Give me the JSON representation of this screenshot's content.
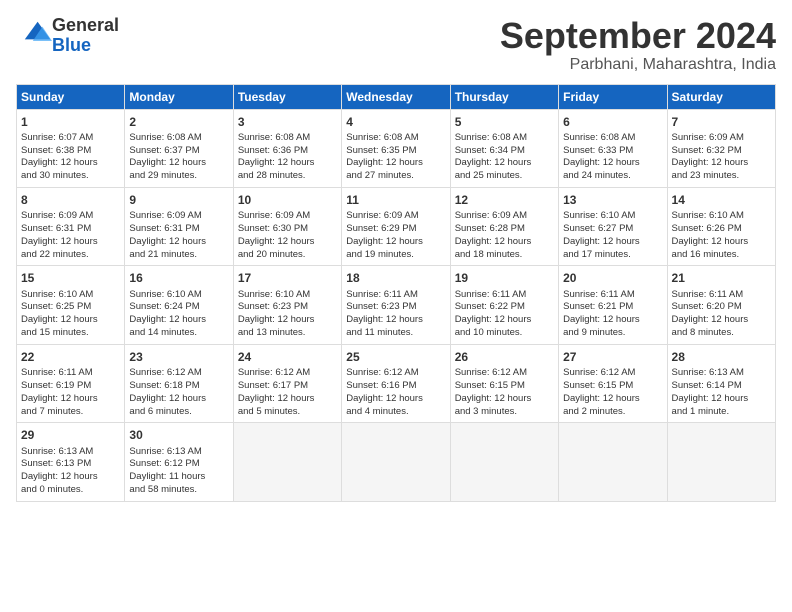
{
  "header": {
    "logo_general": "General",
    "logo_blue": "Blue",
    "month_title": "September 2024",
    "location": "Parbhani, Maharashtra, India"
  },
  "days_of_week": [
    "Sunday",
    "Monday",
    "Tuesday",
    "Wednesday",
    "Thursday",
    "Friday",
    "Saturday"
  ],
  "weeks": [
    [
      {
        "day": "1",
        "lines": [
          "Sunrise: 6:07 AM",
          "Sunset: 6:38 PM",
          "Daylight: 12 hours",
          "and 30 minutes."
        ]
      },
      {
        "day": "2",
        "lines": [
          "Sunrise: 6:08 AM",
          "Sunset: 6:37 PM",
          "Daylight: 12 hours",
          "and 29 minutes."
        ]
      },
      {
        "day": "3",
        "lines": [
          "Sunrise: 6:08 AM",
          "Sunset: 6:36 PM",
          "Daylight: 12 hours",
          "and 28 minutes."
        ]
      },
      {
        "day": "4",
        "lines": [
          "Sunrise: 6:08 AM",
          "Sunset: 6:35 PM",
          "Daylight: 12 hours",
          "and 27 minutes."
        ]
      },
      {
        "day": "5",
        "lines": [
          "Sunrise: 6:08 AM",
          "Sunset: 6:34 PM",
          "Daylight: 12 hours",
          "and 25 minutes."
        ]
      },
      {
        "day": "6",
        "lines": [
          "Sunrise: 6:08 AM",
          "Sunset: 6:33 PM",
          "Daylight: 12 hours",
          "and 24 minutes."
        ]
      },
      {
        "day": "7",
        "lines": [
          "Sunrise: 6:09 AM",
          "Sunset: 6:32 PM",
          "Daylight: 12 hours",
          "and 23 minutes."
        ]
      }
    ],
    [
      {
        "day": "8",
        "lines": [
          "Sunrise: 6:09 AM",
          "Sunset: 6:31 PM",
          "Daylight: 12 hours",
          "and 22 minutes."
        ]
      },
      {
        "day": "9",
        "lines": [
          "Sunrise: 6:09 AM",
          "Sunset: 6:31 PM",
          "Daylight: 12 hours",
          "and 21 minutes."
        ]
      },
      {
        "day": "10",
        "lines": [
          "Sunrise: 6:09 AM",
          "Sunset: 6:30 PM",
          "Daylight: 12 hours",
          "and 20 minutes."
        ]
      },
      {
        "day": "11",
        "lines": [
          "Sunrise: 6:09 AM",
          "Sunset: 6:29 PM",
          "Daylight: 12 hours",
          "and 19 minutes."
        ]
      },
      {
        "day": "12",
        "lines": [
          "Sunrise: 6:09 AM",
          "Sunset: 6:28 PM",
          "Daylight: 12 hours",
          "and 18 minutes."
        ]
      },
      {
        "day": "13",
        "lines": [
          "Sunrise: 6:10 AM",
          "Sunset: 6:27 PM",
          "Daylight: 12 hours",
          "and 17 minutes."
        ]
      },
      {
        "day": "14",
        "lines": [
          "Sunrise: 6:10 AM",
          "Sunset: 6:26 PM",
          "Daylight: 12 hours",
          "and 16 minutes."
        ]
      }
    ],
    [
      {
        "day": "15",
        "lines": [
          "Sunrise: 6:10 AM",
          "Sunset: 6:25 PM",
          "Daylight: 12 hours",
          "and 15 minutes."
        ]
      },
      {
        "day": "16",
        "lines": [
          "Sunrise: 6:10 AM",
          "Sunset: 6:24 PM",
          "Daylight: 12 hours",
          "and 14 minutes."
        ]
      },
      {
        "day": "17",
        "lines": [
          "Sunrise: 6:10 AM",
          "Sunset: 6:23 PM",
          "Daylight: 12 hours",
          "and 13 minutes."
        ]
      },
      {
        "day": "18",
        "lines": [
          "Sunrise: 6:11 AM",
          "Sunset: 6:23 PM",
          "Daylight: 12 hours",
          "and 11 minutes."
        ]
      },
      {
        "day": "19",
        "lines": [
          "Sunrise: 6:11 AM",
          "Sunset: 6:22 PM",
          "Daylight: 12 hours",
          "and 10 minutes."
        ]
      },
      {
        "day": "20",
        "lines": [
          "Sunrise: 6:11 AM",
          "Sunset: 6:21 PM",
          "Daylight: 12 hours",
          "and 9 minutes."
        ]
      },
      {
        "day": "21",
        "lines": [
          "Sunrise: 6:11 AM",
          "Sunset: 6:20 PM",
          "Daylight: 12 hours",
          "and 8 minutes."
        ]
      }
    ],
    [
      {
        "day": "22",
        "lines": [
          "Sunrise: 6:11 AM",
          "Sunset: 6:19 PM",
          "Daylight: 12 hours",
          "and 7 minutes."
        ]
      },
      {
        "day": "23",
        "lines": [
          "Sunrise: 6:12 AM",
          "Sunset: 6:18 PM",
          "Daylight: 12 hours",
          "and 6 minutes."
        ]
      },
      {
        "day": "24",
        "lines": [
          "Sunrise: 6:12 AM",
          "Sunset: 6:17 PM",
          "Daylight: 12 hours",
          "and 5 minutes."
        ]
      },
      {
        "day": "25",
        "lines": [
          "Sunrise: 6:12 AM",
          "Sunset: 6:16 PM",
          "Daylight: 12 hours",
          "and 4 minutes."
        ]
      },
      {
        "day": "26",
        "lines": [
          "Sunrise: 6:12 AM",
          "Sunset: 6:15 PM",
          "Daylight: 12 hours",
          "and 3 minutes."
        ]
      },
      {
        "day": "27",
        "lines": [
          "Sunrise: 6:12 AM",
          "Sunset: 6:15 PM",
          "Daylight: 12 hours",
          "and 2 minutes."
        ]
      },
      {
        "day": "28",
        "lines": [
          "Sunrise: 6:13 AM",
          "Sunset: 6:14 PM",
          "Daylight: 12 hours",
          "and 1 minute."
        ]
      }
    ],
    [
      {
        "day": "29",
        "lines": [
          "Sunrise: 6:13 AM",
          "Sunset: 6:13 PM",
          "Daylight: 12 hours",
          "and 0 minutes."
        ]
      },
      {
        "day": "30",
        "lines": [
          "Sunrise: 6:13 AM",
          "Sunset: 6:12 PM",
          "Daylight: 11 hours",
          "and 58 minutes."
        ]
      },
      {
        "day": "",
        "lines": []
      },
      {
        "day": "",
        "lines": []
      },
      {
        "day": "",
        "lines": []
      },
      {
        "day": "",
        "lines": []
      },
      {
        "day": "",
        "lines": []
      }
    ]
  ]
}
